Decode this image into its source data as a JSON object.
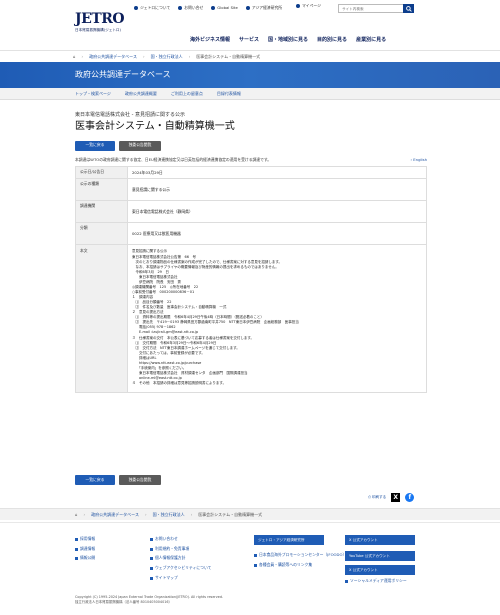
{
  "header": {
    "logo_text": "JETRO",
    "logo_sub": "日本貿易振興機構(ジェトロ)",
    "util_links": [
      "ジェトロについて",
      "お問い合せ",
      "Global Site",
      "アジア経済研究所"
    ],
    "mypage": "マイページ",
    "search_placeholder": "サイト内検索",
    "nav": [
      "海外ビジネス情報",
      "サービス",
      "国・地域別に見る",
      "目的別に見る",
      "産業別に見る"
    ]
  },
  "breadcrumb": [
    "政府公共調達データベース",
    "国・独立行政法人",
    "医事会計システム・自動精算機一式"
  ],
  "banner_title": "政府公共調達データベース",
  "subnav": [
    "トップ・検索ページ",
    "政府公共調達概要",
    "ご利用上の留意点",
    "目録付表情報"
  ],
  "page": {
    "subtitle": "東日本電信電話株式会社 - 意見招請に関する公示",
    "title": "医事会計システム・自動精算機一式",
    "btn_back": "一覧に戻る",
    "btn_bulletin": "独委公告閲覧",
    "notice": "本調達はWTOの政府調達に関する協定、日EU経済連携協定又は日英包括的経済連携協定の適用を受ける調達です。",
    "english": "English"
  },
  "info_table": [
    {
      "label": "公示日/公告日",
      "value": "2024年03月29日"
    },
    {
      "label": "公示の種類",
      "value": "意見招請に関する公示"
    },
    {
      "label": "調達機関",
      "value": "東日本電信電話株式会社（静岡県）"
    },
    {
      "label": "分類",
      "value": "0022 医療用又は獣医用機器"
    },
    {
      "label": "本文",
      "value": "意見招請に関する公示\n東日本電信電話株式会社公告第　66　号\n　次のとおり調達物品の仕様書案の作成が完了したので、仕様書案に対する意見を招請します。\n　なお、本招請はサプライヤの概要情報及び財産的情報の提出を求めるものではありません。\n　令和6年3月　29　日\n　　東日本電信電話株式会社\n　　伊豆病院　院長　安田　秀\n◎調達機関番号　125　◎所在地番号　22\n○事前受付番号　000200000836－01\n１　調達内容\n　⑴　品目分類番号　22\n　⑵　件名及び数量　医事会計システム・自動精算機　一式\n２　意見の提出方法\n　⑴　資料等の提出期限　令和6年4月29日午後4時（日本時間）（郵送必着のこと）\n　⑵　提出先　〒419－0193 静岡県田方郡函南町平井750　NTT東日本伊豆病院　企画総務部　医事担当\n　　電話(055) 978－1862\n　　E-mail :izujirali-gm@east.ntt.co.jp\n３　仕様書案の交付　本公表に基づいて応募する者は仕様書案を交付します。\n　⑴　交付期間　令和6年3月29日～令和6年4月29日\n　⑵　交付方法　NTT東日本調達ホームページを通じて交付します。\n　　交付にあたっては、事前登録が必要です。\n　　詳細はURL\n　　https://www.ntt-east.co.jp/purchase\n　　「手続案内」を参照ください。\n　　東日本電信電話株式会社　資材調達センタ　企画部門　国際調達担当\n　　online-ml@east.ntt.co.jp\n４　その他　本招請の詳細は意見等招請説明書によります。"
    }
  ],
  "share": {
    "print": "印刷する"
  },
  "footer_breadcrumb": [
    "政府公共調達データベース",
    "国・独立行政法人",
    "医事会計システム・自動精算機一式"
  ],
  "footer": {
    "col1": [
      "採用情報",
      "調達情報",
      "情報公開"
    ],
    "col2": [
      "お問い合わせ",
      "利用規約・免責事項",
      "個人情報保護方針",
      "ウェブアクセシビリティについて",
      "サイトマップ"
    ],
    "blue_buttons": [
      "ジェトロ・アジア経済研究所",
      "X 公式アカウント",
      "YouTube 公式アカウント",
      "X 公式アカウント"
    ],
    "col3": [
      "日本食品海外プロモーションセンター（JFOODO）",
      "各種会員・購読等へのリンク集"
    ],
    "col4": [
      "ソーシャルメディア運用ポリシー"
    ],
    "copyright": "Copyright (C) 1995-2024 Japan External Trade Organization(JETRO). All rights reserved.",
    "corp": "独立行政法人日本貿易振興機構（法人番号 8010405004016）"
  }
}
